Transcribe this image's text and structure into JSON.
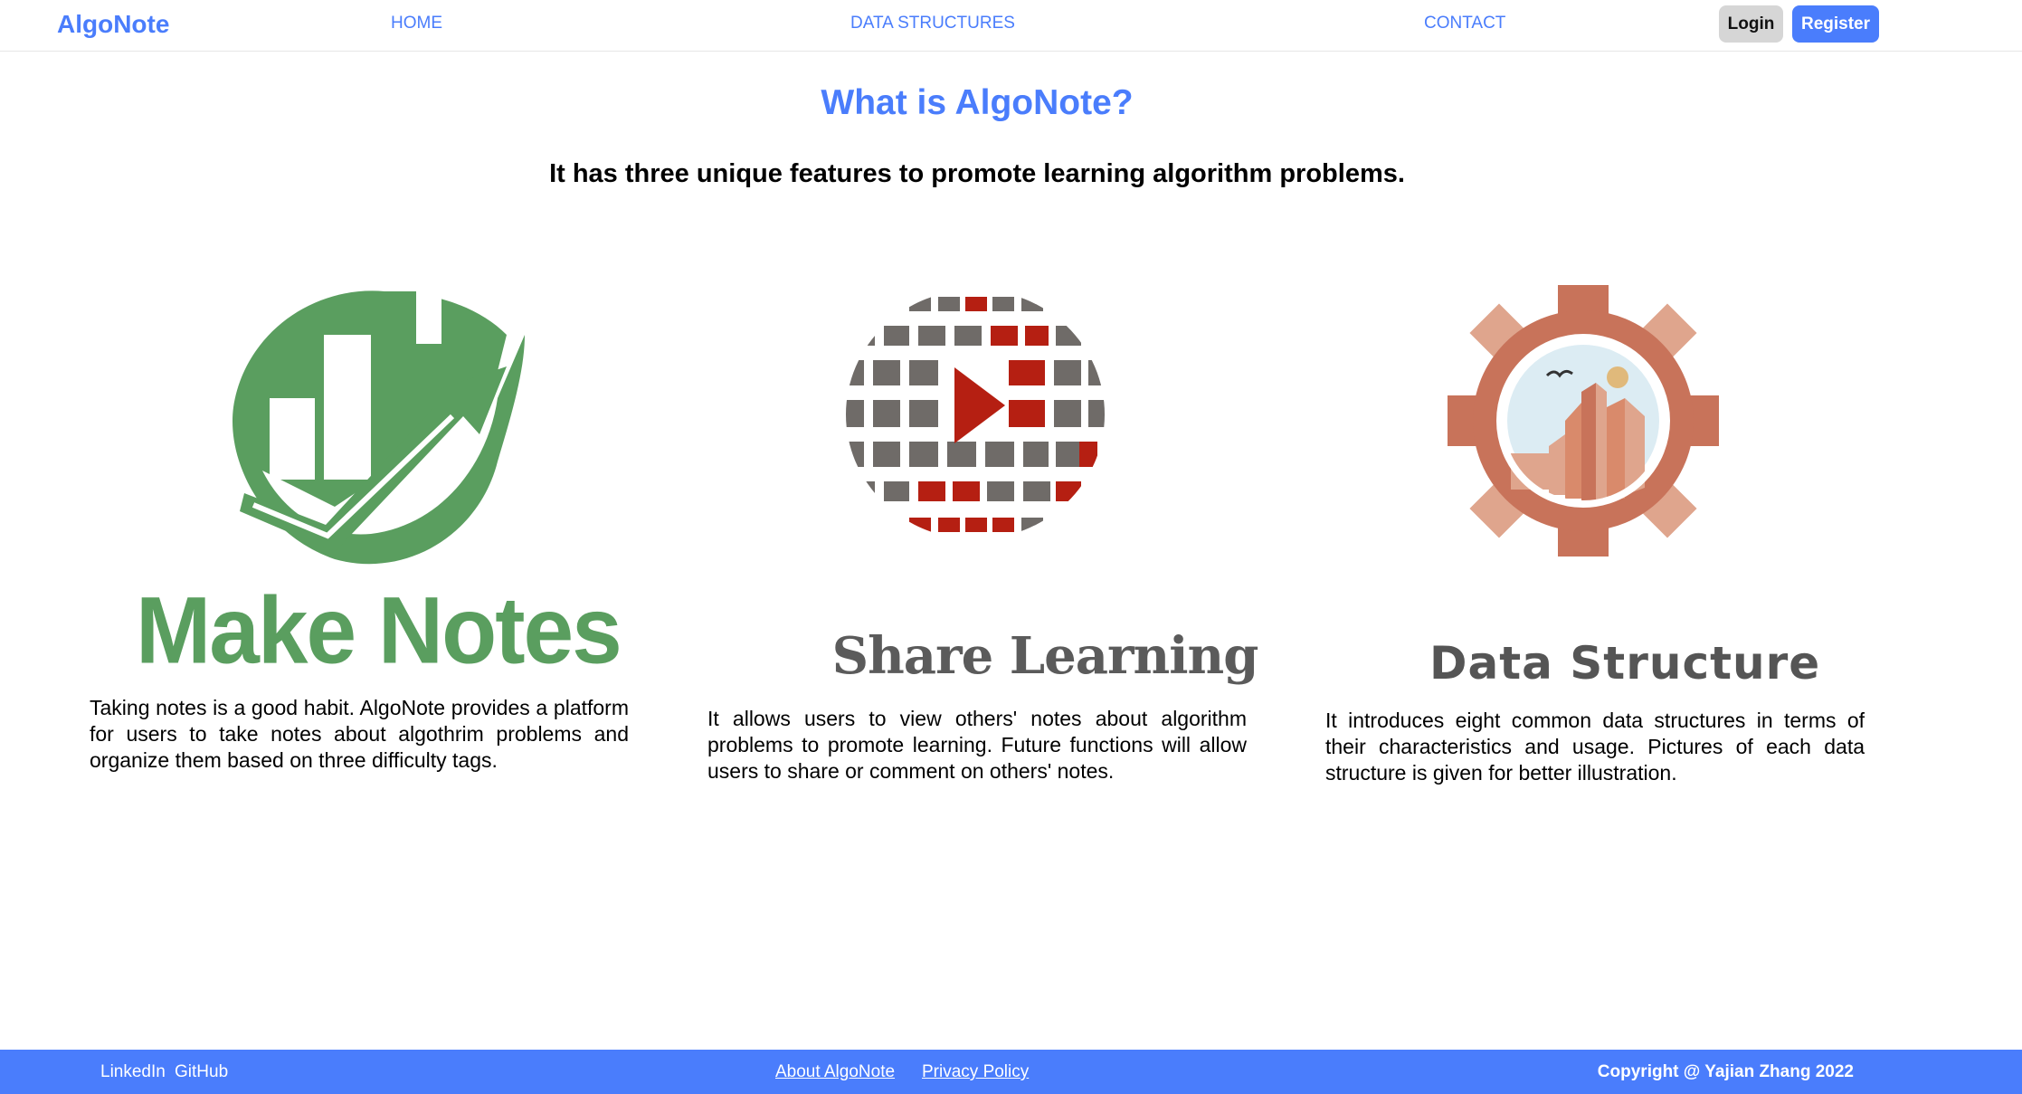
{
  "navbar": {
    "brand": "AlgoNote",
    "links": [
      "HOME",
      "DATA STRUCTURES",
      "CONTACT"
    ],
    "login_label": "Login",
    "register_label": "Register"
  },
  "main": {
    "title": "What is AlgoNote?",
    "subtitle": "It has three unique features to promote learning algorithm problems.",
    "features": [
      {
        "logo_text": "Make Notes",
        "icon": "bar-chart-leaf-icon",
        "description": "Taking notes is a good habit. AlgoNote provides a platform for users to take notes about algothrim problems and organize them based on three difficulty tags."
      },
      {
        "logo_text": "Share Learning",
        "icon": "globe-play-icon",
        "description": "It allows users to view others' notes about algorithm problems to promote learning. Future functions will allow users to share or comment on others' notes."
      },
      {
        "logo_text": "Data Structure",
        "icon": "gear-city-icon",
        "description": "It introduces eight common data structures in terms of their characteristics and usage. Pictures of each data structure is given for better illustration."
      }
    ]
  },
  "footer": {
    "linkedin": "LinkedIn",
    "github": "GitHub",
    "about": "About AlgoNote",
    "privacy": "Privacy Policy",
    "copyright": "Copyright @ Yajian Zhang 2022"
  },
  "colors": {
    "accent": "#4a7dfc",
    "notes_green": "#5a9e5f",
    "globe_red": "#b51f12",
    "globe_grey": "#6f6b68",
    "gear_orange": "#c8735a",
    "gear_light": "#dfa58d"
  }
}
